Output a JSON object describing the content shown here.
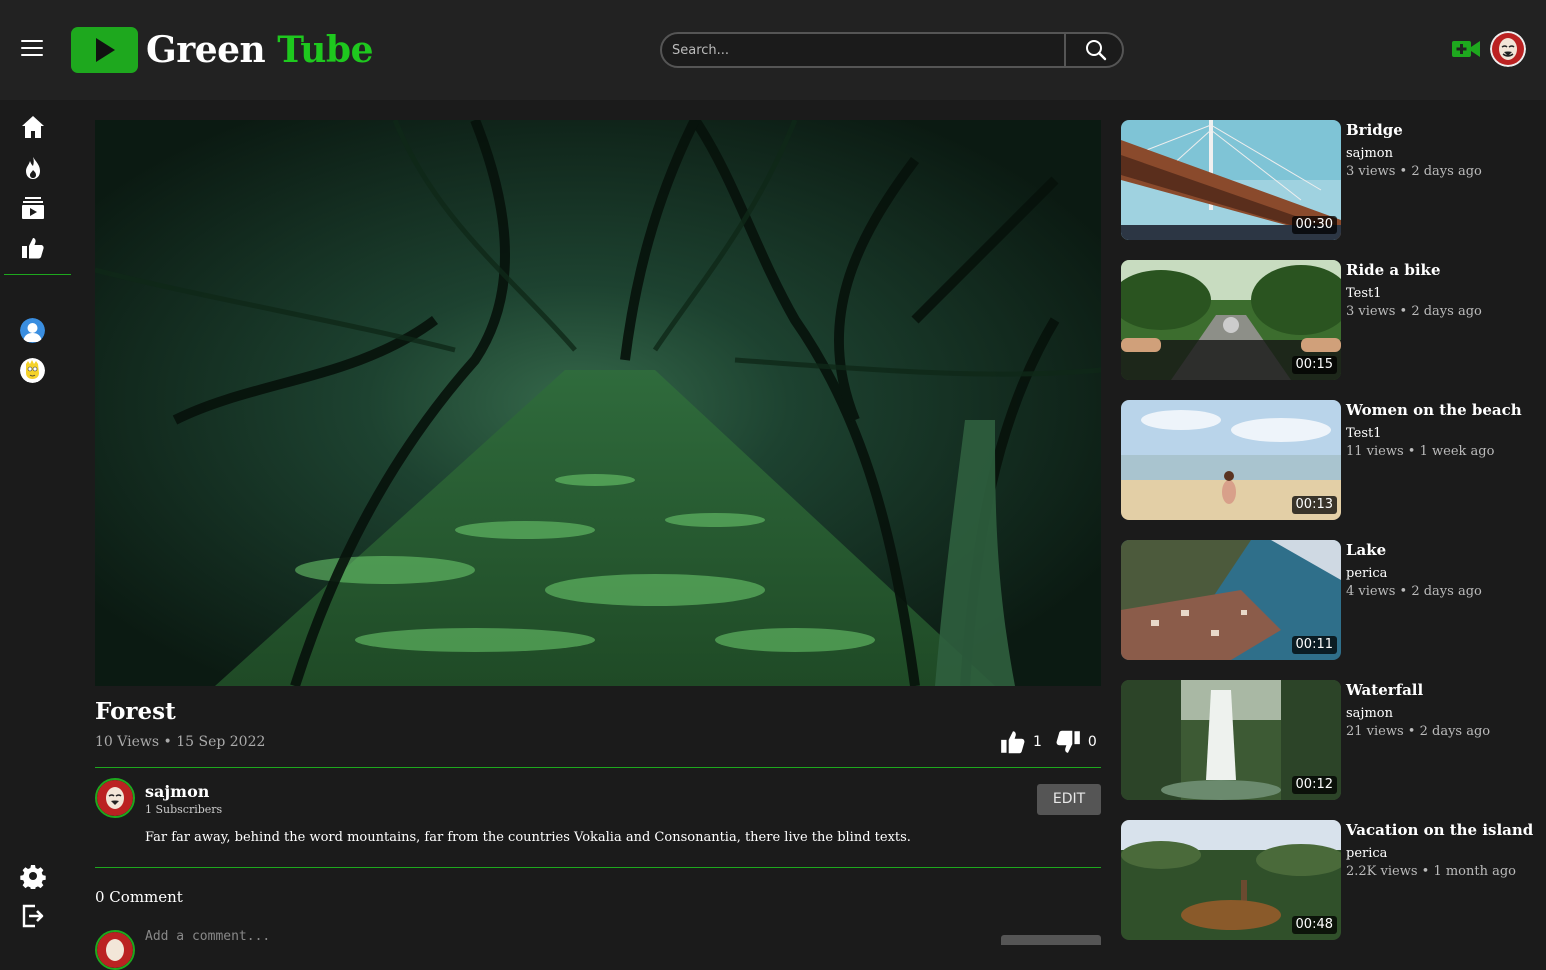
{
  "header": {
    "logo_white": "Green",
    "logo_green": "Tube",
    "search_placeholder": "Search...",
    "menu_icon": "hamburger-menu-icon",
    "upload_icon": "add-video-icon",
    "search_icon": "search-icon"
  },
  "sidebar": {
    "items": [
      {
        "icon": "home-icon"
      },
      {
        "icon": "fire-trending-icon"
      },
      {
        "icon": "subscriptions-icon"
      },
      {
        "icon": "thumbs-up-icon"
      }
    ],
    "bottom": [
      {
        "icon": "gear-icon"
      },
      {
        "icon": "logout-icon"
      }
    ]
  },
  "video": {
    "title": "Forest",
    "meta": "10 Views • 15 Sep 2022",
    "likes": "1",
    "dislikes": "0",
    "channel": "sajmon",
    "subscribers": "1 Subscribers",
    "edit_label": "EDIT",
    "description": "Far far away, behind the word mountains, far from the countries Vokalia and Consonantia, there live the blind texts."
  },
  "comments": {
    "count_label": "0 Comment",
    "placeholder": "Add a comment..."
  },
  "recommendations": [
    {
      "title": "Bridge",
      "author": "sajmon",
      "meta": "3 views • 2 days ago",
      "duration": "00:30"
    },
    {
      "title": "Ride a bike",
      "author": "Test1",
      "meta": "3 views • 2 days ago",
      "duration": "00:15"
    },
    {
      "title": "Women on the beach",
      "author": "Test1",
      "meta": "11 views • 1 week ago",
      "duration": "00:13"
    },
    {
      "title": "Lake",
      "author": "perica",
      "meta": "4 views • 2 days ago",
      "duration": "00:11"
    },
    {
      "title": "Waterfall",
      "author": "sajmon",
      "meta": "21 views • 2 days ago",
      "duration": "00:12"
    },
    {
      "title": "Vacation on the island",
      "author": "perica",
      "meta": "2.2K views • 1 month ago",
      "duration": "00:48"
    }
  ],
  "colors": {
    "accent": "#1ea81e",
    "background": "#1b1b1b",
    "header": "#222222"
  }
}
